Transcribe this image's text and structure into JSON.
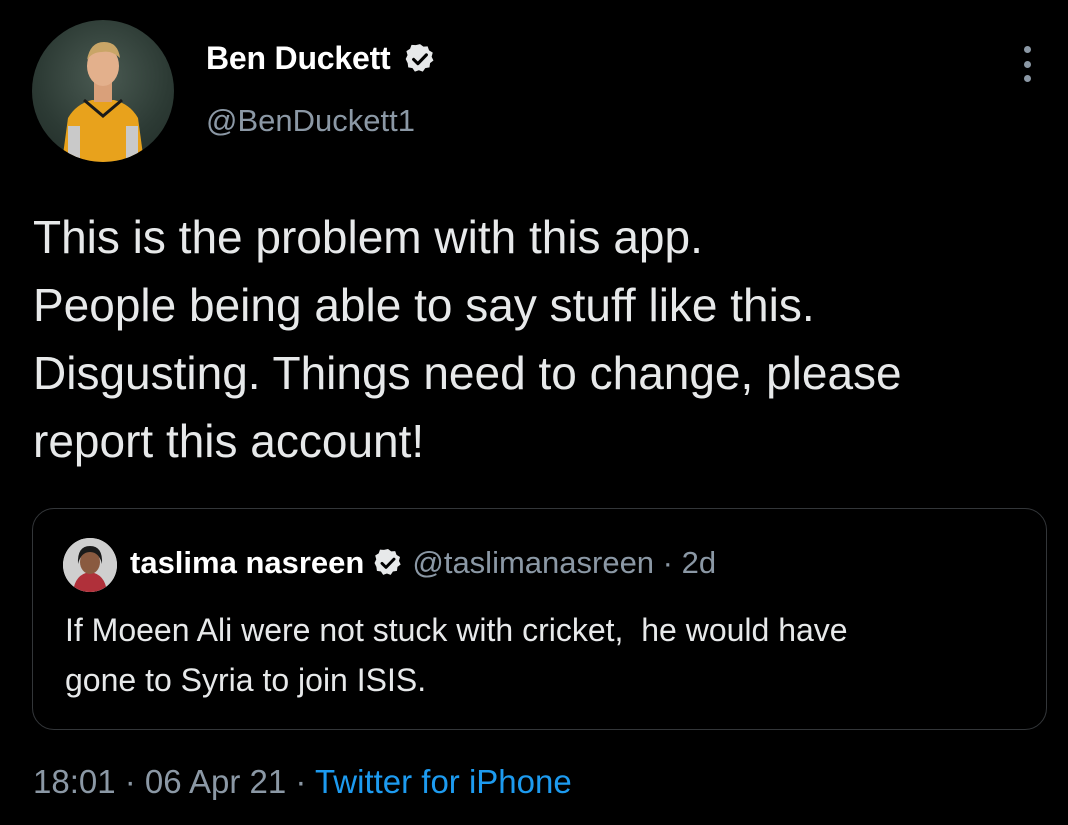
{
  "author": {
    "display_name": "Ben Duckett",
    "handle": "@BenDuckett1"
  },
  "tweet": {
    "lines": [
      "This is the problem with this app.",
      "People being able to say stuff like this.",
      "Disgusting. Things need to change, please",
      "report this account!"
    ]
  },
  "quote": {
    "display_name": "taslima nasreen",
    "handle": "@taslimanasreen",
    "separator": " · ",
    "age": "2d",
    "lines": [
      "If Moeen Ali were not stuck with cricket,  he would have",
      "gone to Syria to join ISIS."
    ]
  },
  "meta": {
    "time": "18:01",
    "sep1": " · ",
    "date": "06 Apr 21",
    "sep2": " · ",
    "source": "Twitter for iPhone"
  },
  "colors": {
    "background": "#000000",
    "secondary_text": "#8b98a5",
    "link": "#1d9bf0",
    "border": "#333639"
  }
}
